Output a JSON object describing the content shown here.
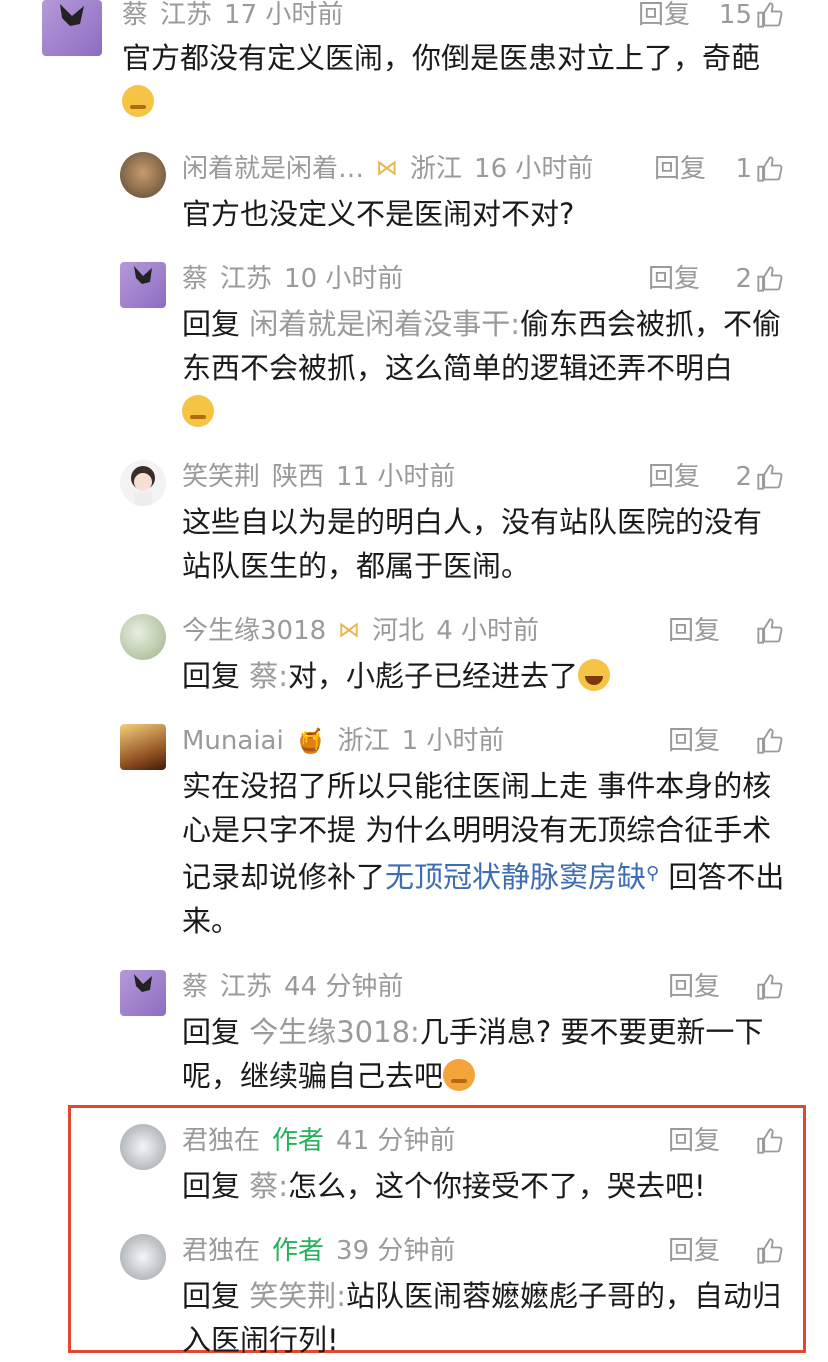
{
  "comments": [
    {
      "user": "蔡",
      "region": "江苏",
      "time": "17 小时前",
      "reply": "回复",
      "likes": "15",
      "text": "官方都没有定义医闹，你倒是医患对立上了，奇葩"
    },
    {
      "user": "闲着就是闲着…",
      "region": "浙江",
      "time": "16 小时前",
      "reply": "回复",
      "likes": "1",
      "text": "官方也没定义不是医闹对不对?"
    },
    {
      "user": "蔡",
      "region": "江苏",
      "time": "10 小时前",
      "reply": "回复",
      "likes": "2",
      "reply_prefix": "回复",
      "reply_to": "闲着就是闲着没事干:",
      "text": "偷东西会被抓，不偷东西不会被抓，这么简单的逻辑还弄不明白"
    },
    {
      "user": "笑笑荆",
      "region": "陕西",
      "time": "11 小时前",
      "reply": "回复",
      "likes": "2",
      "text": "这些自以为是的明白人，没有站队医院的没有站队医生的，都属于医闹。"
    },
    {
      "user": "今生缘3018",
      "region": "河北",
      "time": "4 小时前",
      "reply": "回复",
      "likes": "",
      "reply_prefix": "回复",
      "reply_to": "蔡:",
      "text": "对，小彪子已经进去了"
    },
    {
      "user": "Munaiai",
      "region": "浙江",
      "time": "1 小时前",
      "reply": "回复",
      "likes": "",
      "text_a": "实在没招了所以只能往医闹上走 事件本身的核心是只字不提 为什么明明没有无顶综合征手术记录却说修补了",
      "link": "无顶冠状静脉窦房缺",
      "text_b": " 回答不出来。"
    },
    {
      "user": "蔡",
      "region": "江苏",
      "time": "44 分钟前",
      "reply": "回复",
      "likes": "",
      "reply_prefix": "回复",
      "reply_to": "今生缘3018:",
      "text": "几手消息? 要不要更新一下呢，继续骗自己去吧"
    },
    {
      "user": "君独在",
      "badge": "作者",
      "time": "41 分钟前",
      "reply": "回复",
      "likes": "",
      "reply_prefix": "回复",
      "reply_to": "蔡:",
      "text": "怎么，这个你接受不了，哭去吧!"
    },
    {
      "user": "君独在",
      "badge": "作者",
      "time": "39 分钟前",
      "reply": "回复",
      "likes": "",
      "reply_prefix": "回复",
      "reply_to": "笑笑荆:",
      "text": "站队医闹蓉嬷嬷彪子哥的，自动归入医闹行列!"
    }
  ],
  "colors": {
    "meta": "#9a9a9a",
    "author_badge": "#25b15a",
    "link": "#3d6db5",
    "highlight": "#e2472f"
  }
}
